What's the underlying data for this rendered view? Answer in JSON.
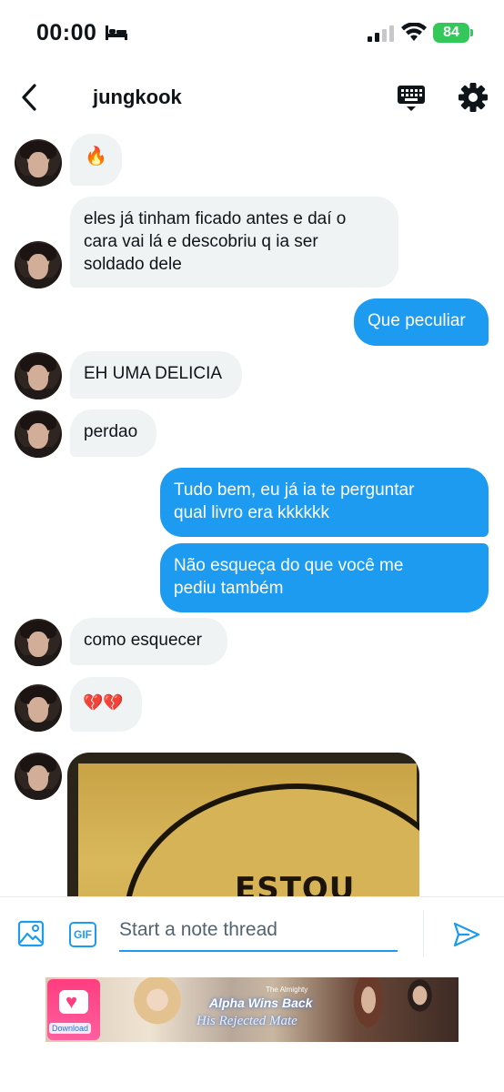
{
  "status_bar": {
    "time": "00:00",
    "battery": "84"
  },
  "header": {
    "title": "jungkook"
  },
  "messages": [
    {
      "side": "in",
      "text": "🔥"
    },
    {
      "side": "in",
      "text": "eles já tinham ficado antes e daí o\ncara vai lá e descobriu q ia ser\nsoldado dele"
    },
    {
      "side": "out",
      "text": "Que peculiar"
    },
    {
      "side": "in",
      "text": "EH UMA DELICIA"
    },
    {
      "side": "in",
      "text": "perdao"
    },
    {
      "side": "out",
      "text": "Tudo bem, eu já ia te perguntar\nqual livro era kkkkkk"
    },
    {
      "side": "out",
      "text": "Não esqueça do que você me\npediu também"
    },
    {
      "side": "in",
      "text": "como esquecer"
    },
    {
      "side": "in",
      "text": "💔💔"
    },
    {
      "side": "in",
      "type": "image",
      "image_text": "ESTOU"
    }
  ],
  "composer": {
    "placeholder": "Start a note thread",
    "gif_label": "GIF"
  },
  "ad": {
    "download_label": "Download",
    "small_text": "The Almighty",
    "title": "Alpha Wins Back",
    "subtitle": "His Rejected Mate"
  }
}
